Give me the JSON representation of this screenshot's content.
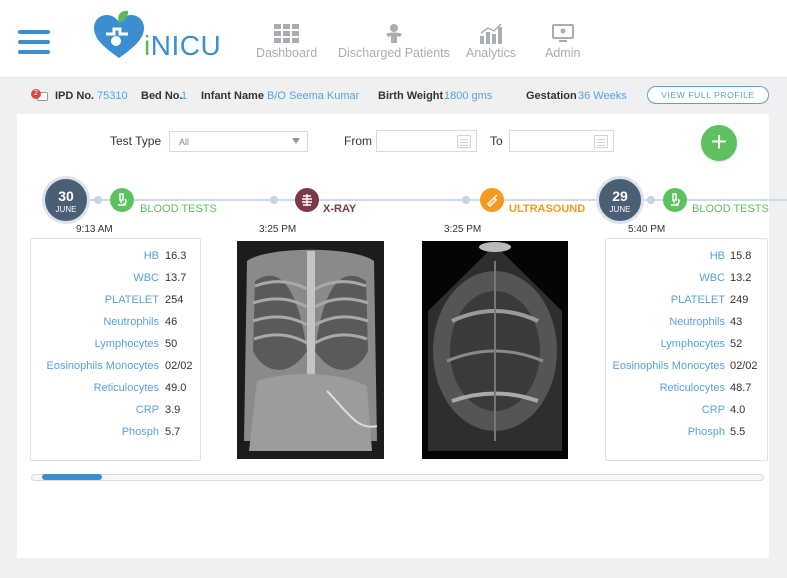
{
  "header": {
    "brand": "iNICU",
    "nav": [
      {
        "label": "Dashboard",
        "icon": "dashboard-grid-icon"
      },
      {
        "label": "Discharged Patients",
        "icon": "discharged-baby-icon"
      },
      {
        "label": "Analytics",
        "icon": "analytics-chart-icon"
      },
      {
        "label": "Admin",
        "icon": "admin-monitor-icon"
      }
    ]
  },
  "patient": {
    "badge_count": "2",
    "ipd_label": "IPD No.",
    "ipd_value": "75310",
    "bed_label": "Bed No.",
    "bed_value": "1",
    "name_label": "Infant Name",
    "name_value": "B/O Seema Kumar",
    "weight_label": "Birth Weight",
    "weight_value": "1800 gms",
    "gestation_label": "Gestation",
    "gestation_value": "36 Weeks",
    "profile_button": "VIEW FULL PROFILE"
  },
  "filters": {
    "test_type_label": "Test Type",
    "test_type_value": "All",
    "from_label": "From",
    "to_label": "To"
  },
  "timeline": {
    "dates": [
      {
        "day": "30",
        "month": "JUNE"
      },
      {
        "day": "29",
        "month": "JUNE"
      }
    ],
    "events": [
      {
        "type": "BLOOD TESTS",
        "time": "9:13 AM",
        "color": "#5cc15e",
        "icon": "microscope-icon"
      },
      {
        "type": "X-RAY",
        "time": "3:25 PM",
        "color": "#7a3a4c",
        "icon": "ribcage-icon"
      },
      {
        "type": "ULTRASOUND",
        "time": "3:25 PM",
        "color": "#f39a1f",
        "icon": "ultrasound-probe-icon"
      },
      {
        "type": "BLOOD TESTS",
        "time": "5:40 PM",
        "color": "#5cc15e",
        "icon": "microscope-icon"
      }
    ]
  },
  "blood_tests": [
    {
      "rows": [
        {
          "k": "HB",
          "v": "16.3"
        },
        {
          "k": "WBC",
          "v": "13.7"
        },
        {
          "k": "PLATELET",
          "v": "254"
        },
        {
          "k": "Neutrophils",
          "v": "46"
        },
        {
          "k": "Lymphocytes",
          "v": "50"
        },
        {
          "k": "Eosinophils Monocytes",
          "v": "02/02"
        },
        {
          "k": "Reticulocytes",
          "v": "49.0"
        },
        {
          "k": "CRP",
          "v": "3.9"
        },
        {
          "k": "Phosph",
          "v": "5.7"
        }
      ]
    },
    {
      "rows": [
        {
          "k": "HB",
          "v": "15.8"
        },
        {
          "k": "WBC",
          "v": "13.2"
        },
        {
          "k": "PLATELET",
          "v": "249"
        },
        {
          "k": "Neutrophils",
          "v": "43"
        },
        {
          "k": "Lymphocytes",
          "v": "52"
        },
        {
          "k": "Eosinophils Monocytes",
          "v": "02/02"
        },
        {
          "k": "Reticulocytes",
          "v": "48.7"
        },
        {
          "k": "CRP",
          "v": "4.0"
        },
        {
          "k": "Phosph",
          "v": "5.5"
        }
      ]
    }
  ],
  "colors": {
    "accent": "#3b8fd1",
    "link": "#5aa0dd",
    "add": "#5cc15e",
    "date_circle": "#4b5f74"
  }
}
